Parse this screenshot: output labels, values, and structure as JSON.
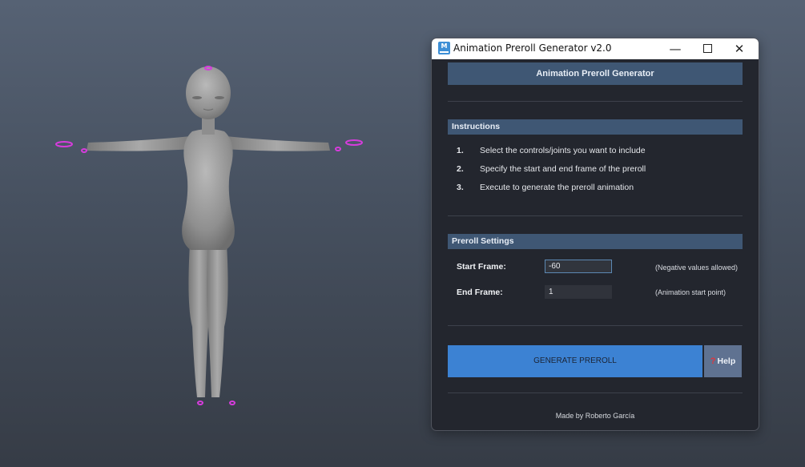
{
  "window": {
    "title": "Animation Preroll Generator v2.0",
    "icon_letter": "M",
    "minimize_glyph": "—",
    "close_glyph": "✕"
  },
  "header": {
    "title": "Animation Preroll Generator"
  },
  "instructions": {
    "title": "Instructions",
    "steps": [
      {
        "num": "1.",
        "text": "Select the controls/joints you want to include"
      },
      {
        "num": "2.",
        "text": "Specify the start and end frame of the preroll"
      },
      {
        "num": "3.",
        "text": "Execute to generate the preroll animation"
      }
    ]
  },
  "settings": {
    "title": "Preroll Settings",
    "start": {
      "label": "Start Frame:",
      "value": "-60",
      "hint": "(Negative values allowed)"
    },
    "end": {
      "label": "End Frame:",
      "value": "1",
      "hint": "(Animation start point)"
    }
  },
  "actions": {
    "generate_label": "GENERATE PREROLL",
    "help_label": "Help",
    "help_icon": "?"
  },
  "footer": {
    "credit": "Made by Roberto García"
  },
  "colors": {
    "accent_blue": "#3c82d3",
    "section_header": "#3f5774",
    "window_bg": "#23262e",
    "control_highlight": "#d63cdc"
  }
}
